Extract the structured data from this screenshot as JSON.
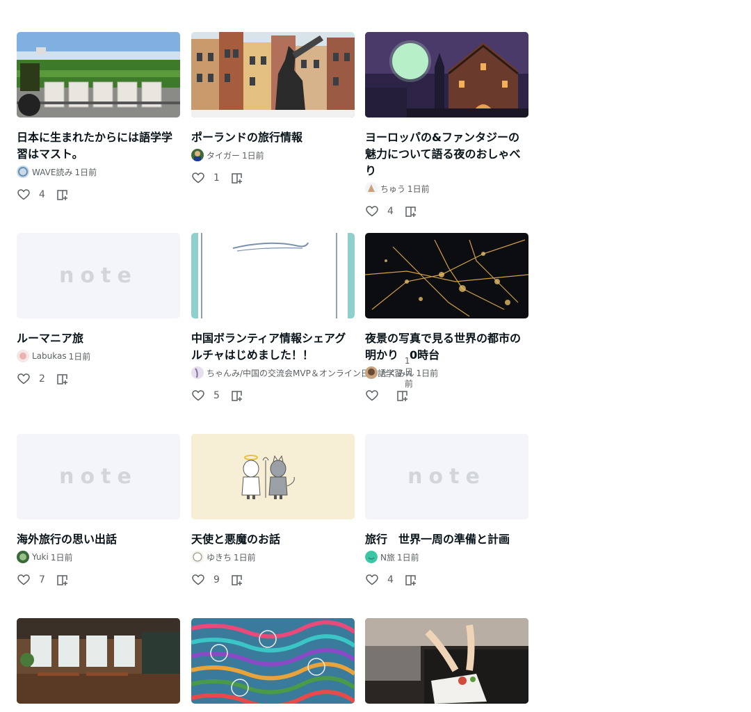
{
  "cards": [
    {
      "title": "日本に生まれたからには語学学習はマスト。",
      "author": "WAVE読み",
      "date": "1日前",
      "likes": "4",
      "thumb": "tractor-field"
    },
    {
      "title": "ポーランドの旅行情報",
      "author": "タイガー",
      "date": "1日前",
      "likes": "1",
      "thumb": "warsaw-mermaid"
    },
    {
      "title": "ヨーロッパの&ファンタジーの魅力について語る夜のおしゃべり",
      "author": "ちゅう",
      "date": "1日前",
      "likes": "4",
      "thumb": "moon-castle"
    },
    {
      "title": "ルーマニア旅",
      "author": "Labukas",
      "date": "1日前",
      "likes": "2",
      "thumb": "note-placeholder"
    },
    {
      "title": "中国ボランティア情報シェアグルチャはじめました！！",
      "author": "ちゃんみ/中国の交流会MVP＆オンライン日本語学習",
      "date": "1日前",
      "likes": "5",
      "thumb": "volunteer-banner"
    },
    {
      "title": "夜景の写真で見る世界の都市の明かり　0時台",
      "author": "たくみん",
      "date": "1日前",
      "likes": "",
      "thumb": "city-lights"
    },
    {
      "title": "海外旅行の思い出話",
      "author": "Yuki",
      "date": "1日前",
      "likes": "7",
      "thumb": "note-placeholder"
    },
    {
      "title": "天使と悪魔のお話",
      "author": "ゆきち",
      "date": "1日前",
      "likes": "9",
      "thumb": "angel-devil"
    },
    {
      "title": "旅行　世界一周の準備と計画",
      "author": "N旅",
      "date": "1日前",
      "likes": "4",
      "thumb": "note-placeholder"
    }
  ],
  "bottom_thumbs": [
    "cafe-interior",
    "colorful-bags",
    "chef-plating"
  ],
  "placeholder_logo": "note",
  "icons": {
    "like": "heart-icon",
    "save": "magazine-add-icon"
  },
  "colors": {
    "text": "#08131a",
    "meta": "#5a5f63",
    "placeholder_bg": "#f3f5f8"
  }
}
